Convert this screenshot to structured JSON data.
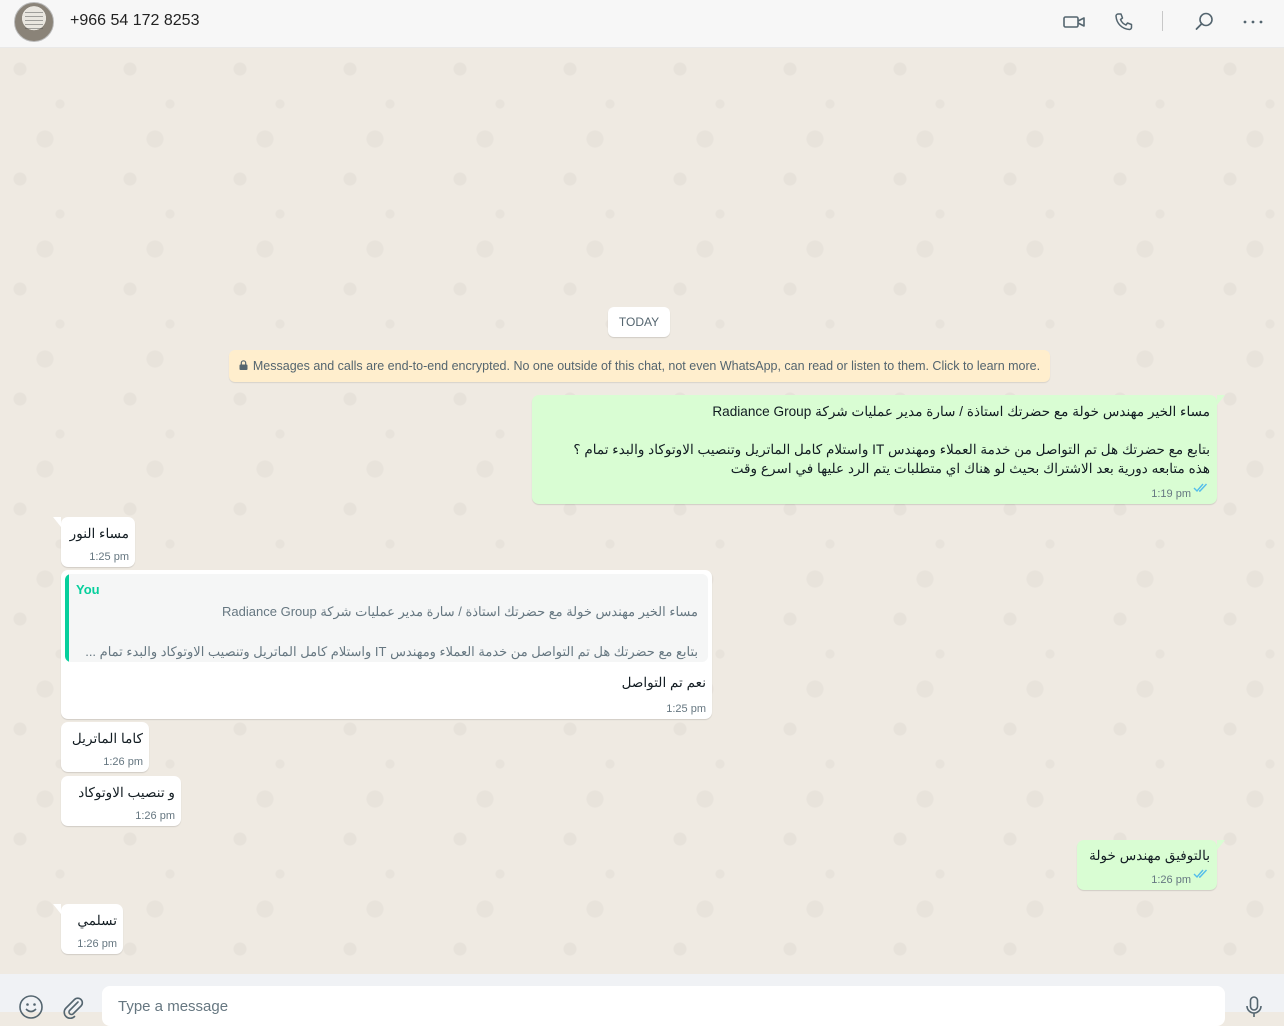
{
  "header": {
    "contact_name": "+966 54 172 8253",
    "icons": [
      "video-call-icon",
      "voice-call-icon",
      "search-icon",
      "more-options-icon"
    ]
  },
  "chat": {
    "date_divider": "TODAY",
    "encryption_notice": "Messages and calls are end-to-end encrypted. No one outside of this chat, not even WhatsApp, can read or listen to them. Click to learn more.",
    "messages": [
      {
        "direction": "outgoing",
        "lines": [
          "مساء الخير مهندس خولة مع حضرتك استاذة / سارة مدير عمليات شركة Radiance Group",
          "بتابع مع حضرتك هل تم التواصل من خدمة العملاء ومهندس IT واستلام كامل الماتريل وتنصيب الاوتوكاد والبدء تمام ؟",
          "هذه متابعه دورية بعد الاشتراك بحيث لو هناك اي متطلبات يتم الرد عليها في اسرع وقت"
        ],
        "time": "1:19 pm",
        "status": "read"
      },
      {
        "direction": "incoming",
        "text": "مساء النور",
        "time": "1:25 pm"
      },
      {
        "direction": "incoming",
        "quoted": {
          "author": "You",
          "line1": "مساء الخير مهندس خولة مع حضرتك استاذة / سارة مدير عمليات شركة Radiance Group",
          "line2": "بتابع مع حضرتك هل تم التواصل من خدمة العملاء ومهندس IT واستلام كامل الماتريل وتنصيب الاوتوكاد والبدء تمام ..."
        },
        "text": "نعم تم التواصل",
        "time": "1:25 pm"
      },
      {
        "direction": "incoming",
        "text": "كاما الماتريل",
        "time": "1:26 pm"
      },
      {
        "direction": "incoming",
        "text": "و تنصيب الاوتوكاد",
        "time": "1:26 pm"
      },
      {
        "direction": "outgoing",
        "text": "بالتوفيق مهندس خولة",
        "time": "1:26 pm",
        "status": "read"
      },
      {
        "direction": "incoming",
        "text": "تسلمي",
        "time": "1:26 pm"
      }
    ]
  },
  "composer": {
    "placeholder": "Type a message",
    "icons": [
      "emoji-icon",
      "attach-icon",
      "microphone-icon"
    ]
  },
  "colors": {
    "outgoing_bubble": "#d9fdd3",
    "incoming_bubble": "#ffffff",
    "read_ticks": "#53bdeb",
    "quote_accent": "#06cf9c",
    "encryption_banner": "#ffeecd"
  }
}
